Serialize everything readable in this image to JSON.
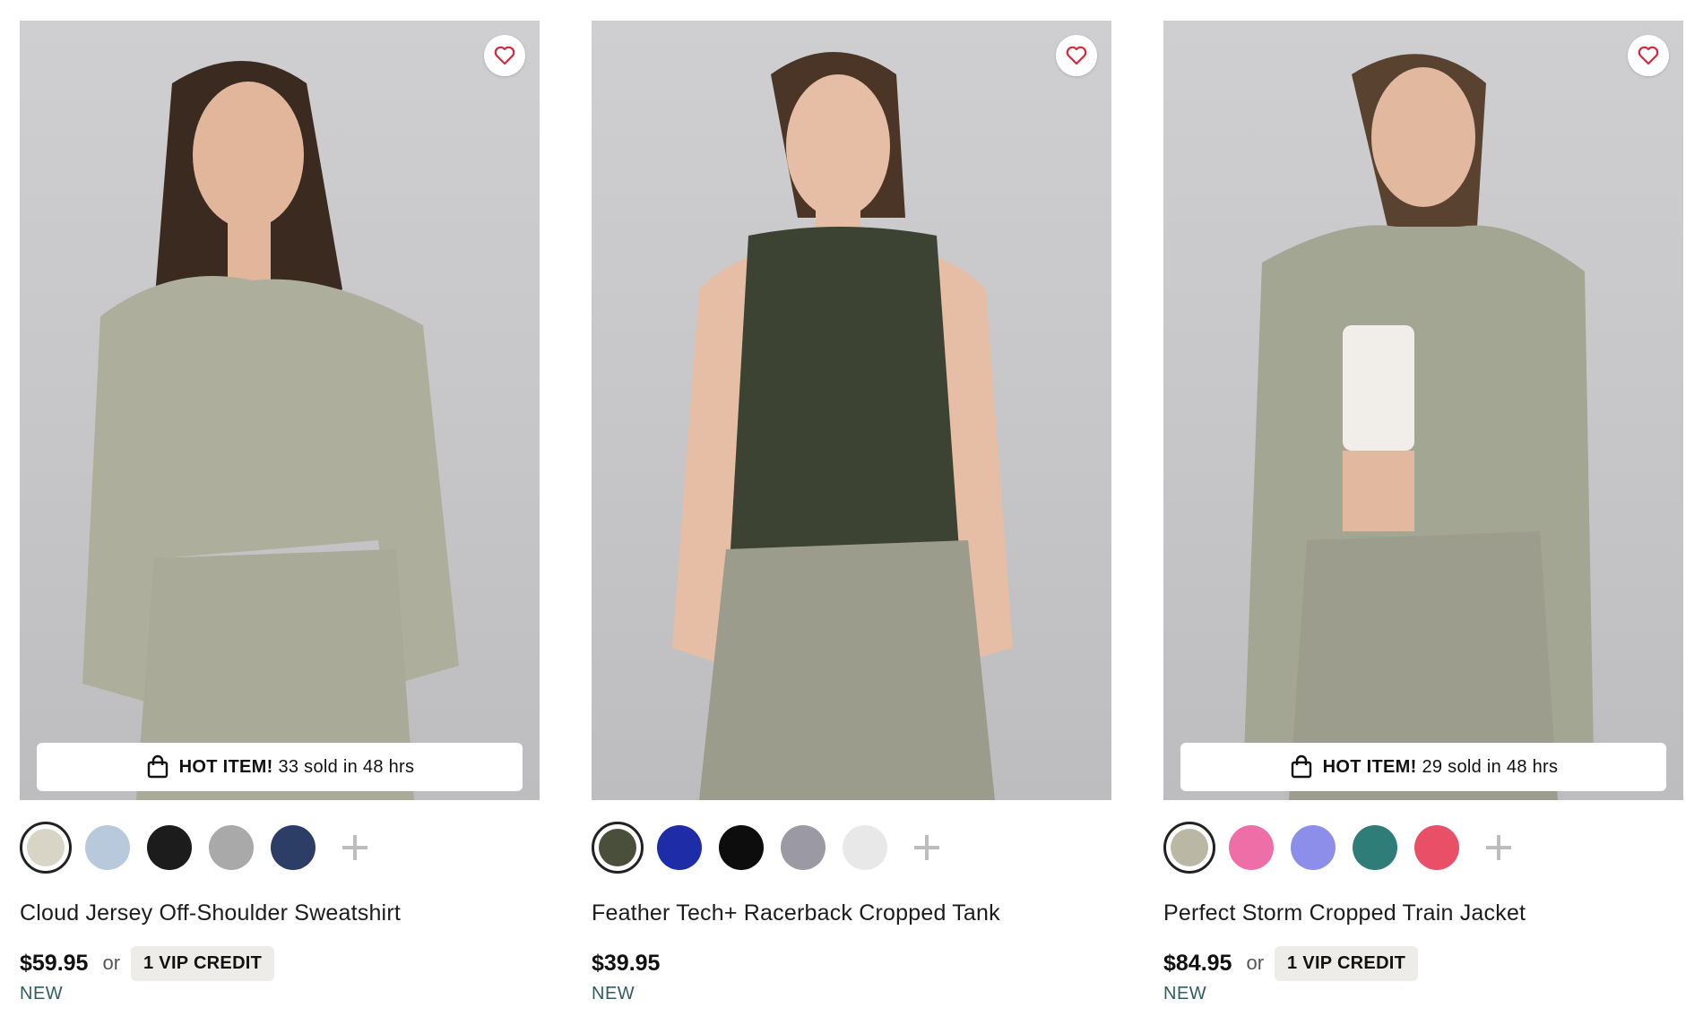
{
  "products": [
    {
      "name": "Cloud Jersey Off-Shoulder Sweatshirt",
      "price": "$59.95",
      "or_text": "or",
      "vip_credit": "1 VIP CREDIT",
      "badge": "NEW",
      "hot_item": {
        "label": "HOT ITEM!",
        "text": "33 sold in 48 hrs"
      },
      "swatches": [
        "#d8d4c6",
        "#b9c9dc",
        "#1c1c1c",
        "#a9a9a9",
        "#2c3d66"
      ],
      "selected_swatch": 0,
      "garment_color": "#aeae9c",
      "bottom_color": "#a9aa98"
    },
    {
      "name": "Feather Tech+ Racerback Cropped Tank",
      "price": "$39.95",
      "or_text": "",
      "vip_credit": "",
      "badge": "NEW",
      "hot_item": null,
      "swatches": [
        "#4a4f3c",
        "#1f2ca8",
        "#0d0d0d",
        "#9b99a3",
        "#e8e8e8"
      ],
      "selected_swatch": 0,
      "garment_color": "#3c4332",
      "bottom_color": "#9b9c8b"
    },
    {
      "name": "Perfect Storm Cropped Train Jacket",
      "price": "$84.95",
      "or_text": "or",
      "vip_credit": "1 VIP CREDIT",
      "badge": "NEW",
      "hot_item": {
        "label": "HOT ITEM!",
        "text": "29 sold in 48 hrs"
      },
      "swatches": [
        "#bab7a5",
        "#ee6fa8",
        "#8d8eea",
        "#2e7d78",
        "#ea4f68"
      ],
      "selected_swatch": 0,
      "garment_color": "#a3a692",
      "bottom_color": "#9c9d8c"
    }
  ],
  "icons": {
    "favorite": "heart-outline-icon",
    "hot": "shopping-bag-icon",
    "more_colors": "plus-icon"
  },
  "colors": {
    "heart": "#d6293c",
    "new_badge": "#2f5d62",
    "vip_bg": "#eeece8"
  }
}
